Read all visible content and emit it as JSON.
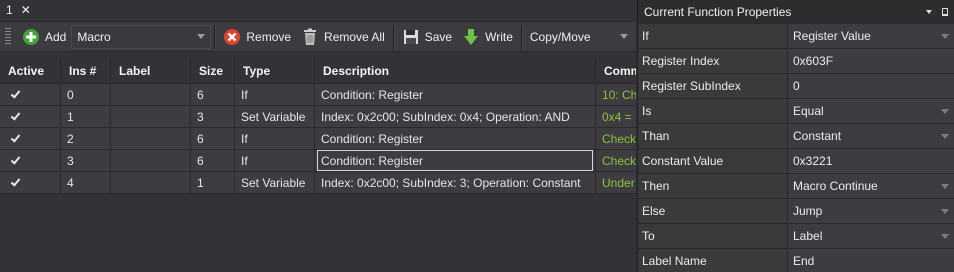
{
  "doc_tab": {
    "label": "1",
    "close": "✕"
  },
  "toolbar": {
    "add_label": "Add",
    "macro_combo": "Macro",
    "remove_label": "Remove",
    "remove_all_label": "Remove All",
    "save_label": "Save",
    "write_label": "Write",
    "copy_move_combo": "Copy/Move"
  },
  "grid": {
    "columns": [
      "Active",
      "Ins #",
      "Label",
      "Size",
      "Type",
      "Description",
      "Comm"
    ],
    "rows": [
      {
        "active": true,
        "ins": "0",
        "label": "",
        "size": "6",
        "type": "If",
        "description": "Condition: Register",
        "comment": "10: Ch"
      },
      {
        "active": true,
        "ins": "1",
        "label": "",
        "size": "3",
        "type": "Set Variable",
        "description": "Index: 0x2c00; SubIndex: 0x4; Operation: AND",
        "comment": "0x4 ="
      },
      {
        "active": true,
        "ins": "2",
        "label": "",
        "size": "6",
        "type": "If",
        "description": "Condition: Register",
        "comment": "Check"
      },
      {
        "active": true,
        "ins": "3",
        "label": "",
        "size": "6",
        "type": "If",
        "description": "Condition: Register",
        "comment": "Check"
      },
      {
        "active": true,
        "ins": "4",
        "label": "",
        "size": "1",
        "type": "Set Variable",
        "description": "Index: 0x2c00; SubIndex: 3; Operation: Constant",
        "comment": "Under"
      }
    ]
  },
  "props": {
    "title": "Current Function Properties",
    "rows": [
      {
        "name": "If",
        "value": "Register Value",
        "dropdown": true
      },
      {
        "name": "Register Index",
        "value": "0x603F",
        "dropdown": false
      },
      {
        "name": "Register SubIndex",
        "value": "0",
        "dropdown": false
      },
      {
        "name": "Is",
        "value": "Equal",
        "dropdown": true
      },
      {
        "name": "Than",
        "value": "Constant",
        "dropdown": true
      },
      {
        "name": "Constant Value",
        "value": "0x3221",
        "dropdown": false
      },
      {
        "name": "Then",
        "value": "Macro Continue",
        "dropdown": true
      },
      {
        "name": "Else",
        "value": "Jump",
        "dropdown": true
      },
      {
        "name": "To",
        "value": "Label",
        "dropdown": true
      },
      {
        "name": "Label Name",
        "value": "End",
        "dropdown": false
      }
    ]
  },
  "colors": {
    "comment_green": "#8fc33a",
    "add_green": "#3fa535",
    "remove_red": "#e0462f",
    "write_green": "#6cc24a"
  }
}
